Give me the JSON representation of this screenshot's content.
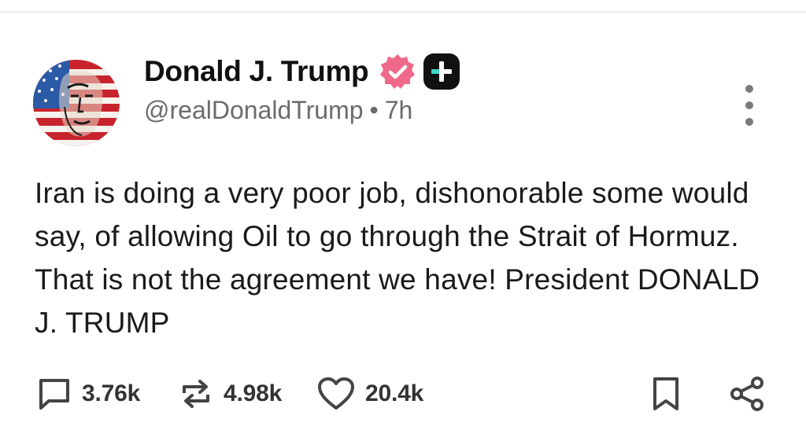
{
  "post": {
    "author": {
      "display_name": "Donald J. Trump",
      "handle": "@realDonaldTrump",
      "time_ago": "7h",
      "separator": "•"
    },
    "body": "Iran is doing a very poor job, dishonorable some would say, of allowing Oil to go through the Strait of Hormuz. That is not the agreement we have! President DONALD J. TRUMP",
    "stats": {
      "replies": "3.76k",
      "reposts": "4.98k",
      "likes": "20.4k"
    }
  },
  "icons": {
    "avatar": "avatar-flag-portrait",
    "verified": "verified-badge-icon",
    "plus": "plus-badge-icon",
    "more": "more-vertical-icon",
    "reply": "comment-icon",
    "repost": "repost-icon",
    "like": "heart-icon",
    "bookmark": "bookmark-icon",
    "share": "share-icon"
  },
  "colors": {
    "verified_badge": "#ef6a8a",
    "plus_badge_bg": "#111111",
    "plus_badge_accent": "#3fd6c6",
    "muted_text": "#6b6b6b"
  }
}
